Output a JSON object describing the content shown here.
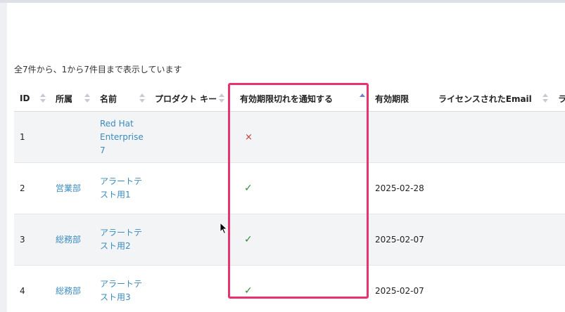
{
  "table_info": "全7件から、1から7件目まで表示しています",
  "columns": [
    {
      "label": "ID"
    },
    {
      "label": "所属"
    },
    {
      "label": "名前"
    },
    {
      "label": "プロダクト キー"
    },
    {
      "label": "有効期限切れを通知する"
    },
    {
      "label": "有効期限"
    },
    {
      "label": "ライセンスされたEmail"
    },
    {
      "label": "ラ"
    }
  ],
  "sorted_column": "有効期限切れを通知する",
  "sort_direction": "ascending",
  "rows": [
    {
      "id": "1",
      "dept": "",
      "name": "Red Hat Enterprise 7",
      "product_key": "",
      "notify": "×",
      "notify_state": "off",
      "expiry": "",
      "email": ""
    },
    {
      "id": "2",
      "dept": "営業部",
      "name": "アラートテスト用1",
      "product_key": "",
      "notify": "✓",
      "notify_state": "on",
      "expiry": "2025-02-28",
      "email": ""
    },
    {
      "id": "3",
      "dept": "総務部",
      "name": "アラートテスト用2",
      "product_key": "",
      "notify": "✓",
      "notify_state": "on",
      "expiry": "2025-02-07",
      "email": ""
    },
    {
      "id": "4",
      "dept": "総務部",
      "name": "アラートテスト用3",
      "product_key": "",
      "notify": "✓",
      "notify_state": "on",
      "expiry": "2025-02-07",
      "email": ""
    }
  ],
  "colors": {
    "link": "#3a8bbb",
    "highlight_border": "#e8336d",
    "check": "#2d8a3e",
    "cross": "#cc3333",
    "sort_active": "#6f84c8"
  }
}
